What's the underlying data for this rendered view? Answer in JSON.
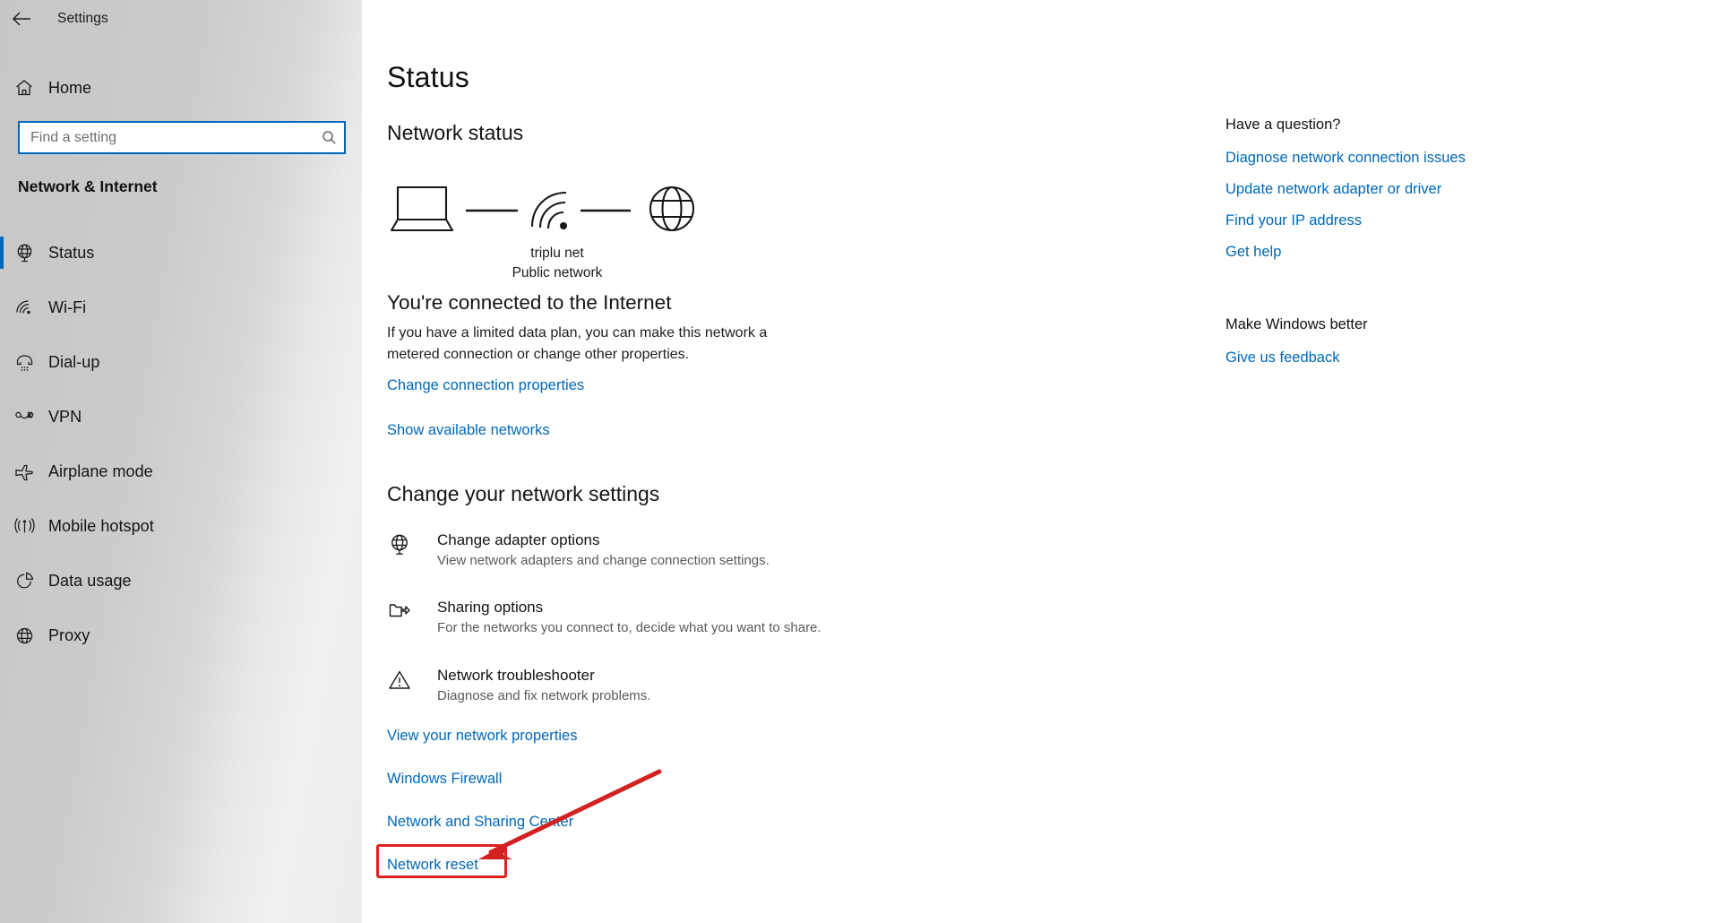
{
  "window": {
    "title": "Settings",
    "back_icon": "back-arrow-icon",
    "controls": {
      "minimize": "minimize-icon",
      "maximize": "maximize-icon",
      "close": "close-icon"
    }
  },
  "sidebar": {
    "home": {
      "label": "Home",
      "icon": "home-icon"
    },
    "search": {
      "placeholder": "Find a setting",
      "value": "",
      "icon": "search-icon"
    },
    "category": "Network & Internet",
    "items": [
      {
        "label": "Status",
        "icon": "globe-status-icon",
        "selected": true
      },
      {
        "label": "Wi-Fi",
        "icon": "wifi-icon",
        "selected": false
      },
      {
        "label": "Dial-up",
        "icon": "dialup-phone-icon",
        "selected": false
      },
      {
        "label": "VPN",
        "icon": "vpn-icon",
        "selected": false
      },
      {
        "label": "Airplane mode",
        "icon": "airplane-icon",
        "selected": false
      },
      {
        "label": "Mobile hotspot",
        "icon": "hotspot-icon",
        "selected": false
      },
      {
        "label": "Data usage",
        "icon": "pie-chart-icon",
        "selected": false
      },
      {
        "label": "Proxy",
        "icon": "globe-icon",
        "selected": false
      }
    ]
  },
  "main": {
    "page_title": "Status",
    "network_status_heading": "Network status",
    "diagram": {
      "device_icon": "laptop-icon",
      "link_icon": "connection-line",
      "middle_icon": "wifi-signal-icon",
      "internet_icon": "globe-icon",
      "network_name": "triplu net",
      "network_type": "Public network"
    },
    "connected_heading": "You're connected to the Internet",
    "connected_description": "If you have a limited data plan, you can make this network a metered connection or change other properties.",
    "link_change_connection": "Change connection properties",
    "link_show_networks": "Show available networks",
    "change_settings_heading": "Change your network settings",
    "settings_rows": [
      {
        "title": "Change adapter options",
        "subtitle": "View network adapters and change connection settings.",
        "icon": "network-adapter-globe-icon"
      },
      {
        "title": "Sharing options",
        "subtitle": "For the networks you connect to, decide what you want to share.",
        "icon": "sharing-folder-icon"
      },
      {
        "title": "Network troubleshooter",
        "subtitle": "Diagnose and fix network problems.",
        "icon": "warning-triangle-icon"
      }
    ],
    "link_view_properties": "View your network properties",
    "link_windows_firewall": "Windows Firewall",
    "link_network_sharing_center": "Network and Sharing Center",
    "link_network_reset": "Network reset"
  },
  "rail": {
    "question_heading": "Have a question?",
    "question_links": [
      "Diagnose network connection issues",
      "Update network adapter or driver",
      "Find your IP address",
      "Get help"
    ],
    "feedback_heading": "Make Windows better",
    "feedback_links": [
      "Give us feedback"
    ]
  },
  "annotation": {
    "highlight_target": "Network reset",
    "box_color": "#e02020",
    "arrow_color": "#d32020"
  },
  "colors": {
    "accent": "#0067b8",
    "link": "#0067b8",
    "sidebar_light": "#f0f0f0",
    "sidebar_dark": "#c7c7c7"
  }
}
